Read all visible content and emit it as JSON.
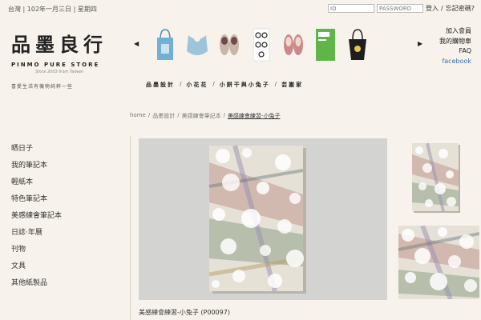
{
  "topbar": {
    "date": "台灣 | 102年一月三日 | 星期四",
    "id_placeholder": "ID",
    "password_placeholder": "PASSWORD",
    "login_label": "登入",
    "forgot_label": "忘記密碼?"
  },
  "logo": {
    "name_zh": "品墨良行",
    "name_en": "PINMO PURE STORE",
    "since": "Since 2003 from Taiwan",
    "tagline": "喜愛生活有機物純粹一些"
  },
  "right_links": [
    "加入會員",
    "我的購物車",
    "FAQ",
    "facebook"
  ],
  "main_nav": [
    "品墨設計",
    "小花花",
    "小餅干與小兔子",
    "芸搬家"
  ],
  "breadcrumb": [
    "home",
    "品墨設計",
    "美感練會筆記本",
    "美感練會練習-小兔子"
  ],
  "sidebar": [
    "晒日子",
    "我的筆記本",
    "輕紙本",
    "特色筆記本",
    "美感練會筆記本",
    "日誌·年曆",
    "刊物",
    "文具",
    "其他紙製品"
  ],
  "product": {
    "title": "美感練會練習-小兔子 (P00097)"
  },
  "icons": {
    "prev": "left-arrow-icon",
    "next": "right-arrow-icon"
  },
  "colors": {
    "background": "#f7f3ec",
    "link_facebook": "#3a6aa8"
  }
}
